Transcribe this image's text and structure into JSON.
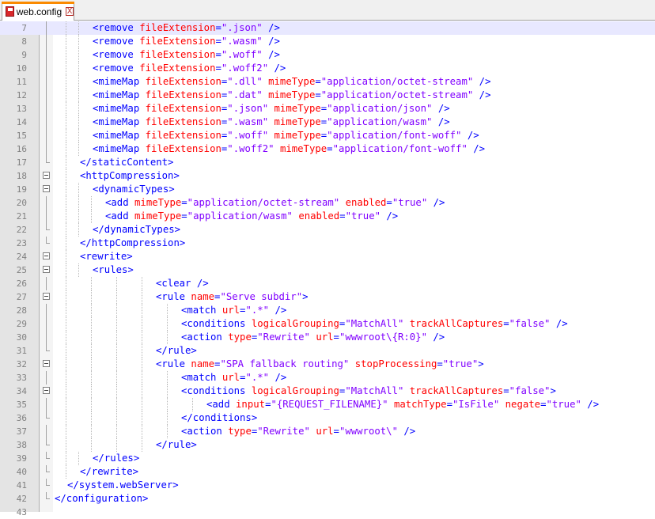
{
  "tab": {
    "label": "web.config",
    "close": "X"
  },
  "editor": {
    "current_line": 7,
    "lines": [
      {
        "n": "7",
        "indent": 3,
        "fold": "line",
        "tokens": [
          [
            "t",
            "<remove "
          ],
          [
            "a",
            "fileExtension"
          ],
          [
            "p",
            "="
          ],
          [
            "v",
            "\".json\""
          ],
          [
            "t",
            " />"
          ]
        ]
      },
      {
        "n": "8",
        "indent": 3,
        "fold": "line",
        "tokens": [
          [
            "t",
            "<remove "
          ],
          [
            "a",
            "fileExtension"
          ],
          [
            "p",
            "="
          ],
          [
            "v",
            "\".wasm\""
          ],
          [
            "t",
            " />"
          ]
        ]
      },
      {
        "n": "9",
        "indent": 3,
        "fold": "line",
        "tokens": [
          [
            "t",
            "<remove "
          ],
          [
            "a",
            "fileExtension"
          ],
          [
            "p",
            "="
          ],
          [
            "v",
            "\".woff\""
          ],
          [
            "t",
            " />"
          ]
        ]
      },
      {
        "n": "10",
        "indent": 3,
        "fold": "line",
        "tokens": [
          [
            "t",
            "<remove "
          ],
          [
            "a",
            "fileExtension"
          ],
          [
            "p",
            "="
          ],
          [
            "v",
            "\".woff2\""
          ],
          [
            "t",
            " />"
          ]
        ]
      },
      {
        "n": "11",
        "indent": 3,
        "fold": "line",
        "tokens": [
          [
            "t",
            "<mimeMap "
          ],
          [
            "a",
            "fileExtension"
          ],
          [
            "p",
            "="
          ],
          [
            "v",
            "\".dll\""
          ],
          [
            "t",
            " "
          ],
          [
            "a",
            "mimeType"
          ],
          [
            "p",
            "="
          ],
          [
            "v",
            "\"application/octet-stream\""
          ],
          [
            "t",
            " />"
          ]
        ]
      },
      {
        "n": "12",
        "indent": 3,
        "fold": "line",
        "tokens": [
          [
            "t",
            "<mimeMap "
          ],
          [
            "a",
            "fileExtension"
          ],
          [
            "p",
            "="
          ],
          [
            "v",
            "\".dat\""
          ],
          [
            "t",
            " "
          ],
          [
            "a",
            "mimeType"
          ],
          [
            "p",
            "="
          ],
          [
            "v",
            "\"application/octet-stream\""
          ],
          [
            "t",
            " />"
          ]
        ]
      },
      {
        "n": "13",
        "indent": 3,
        "fold": "line",
        "tokens": [
          [
            "t",
            "<mimeMap "
          ],
          [
            "a",
            "fileExtension"
          ],
          [
            "p",
            "="
          ],
          [
            "v",
            "\".json\""
          ],
          [
            "t",
            " "
          ],
          [
            "a",
            "mimeType"
          ],
          [
            "p",
            "="
          ],
          [
            "v",
            "\"application/json\""
          ],
          [
            "t",
            " />"
          ]
        ]
      },
      {
        "n": "14",
        "indent": 3,
        "fold": "line",
        "tokens": [
          [
            "t",
            "<mimeMap "
          ],
          [
            "a",
            "fileExtension"
          ],
          [
            "p",
            "="
          ],
          [
            "v",
            "\".wasm\""
          ],
          [
            "t",
            " "
          ],
          [
            "a",
            "mimeType"
          ],
          [
            "p",
            "="
          ],
          [
            "v",
            "\"application/wasm\""
          ],
          [
            "t",
            " />"
          ]
        ]
      },
      {
        "n": "15",
        "indent": 3,
        "fold": "line",
        "tokens": [
          [
            "t",
            "<mimeMap "
          ],
          [
            "a",
            "fileExtension"
          ],
          [
            "p",
            "="
          ],
          [
            "v",
            "\".woff\""
          ],
          [
            "t",
            " "
          ],
          [
            "a",
            "mimeType"
          ],
          [
            "p",
            "="
          ],
          [
            "v",
            "\"application/font-woff\""
          ],
          [
            "t",
            " />"
          ]
        ]
      },
      {
        "n": "16",
        "indent": 3,
        "fold": "line",
        "tokens": [
          [
            "t",
            "<mimeMap "
          ],
          [
            "a",
            "fileExtension"
          ],
          [
            "p",
            "="
          ],
          [
            "v",
            "\".woff2\""
          ],
          [
            "t",
            " "
          ],
          [
            "a",
            "mimeType"
          ],
          [
            "p",
            "="
          ],
          [
            "v",
            "\"application/font-woff\""
          ],
          [
            "t",
            " />"
          ]
        ]
      },
      {
        "n": "17",
        "indent": 2,
        "fold": "end",
        "tokens": [
          [
            "t",
            "</staticContent>"
          ]
        ]
      },
      {
        "n": "18",
        "indent": 2,
        "fold": "box",
        "tokens": [
          [
            "t",
            "<httpCompression>"
          ]
        ]
      },
      {
        "n": "19",
        "indent": 3,
        "fold": "box",
        "tokens": [
          [
            "t",
            "<dynamicTypes>"
          ]
        ]
      },
      {
        "n": "20",
        "indent": 4,
        "fold": "line",
        "tokens": [
          [
            "t",
            "<add "
          ],
          [
            "a",
            "mimeType"
          ],
          [
            "p",
            "="
          ],
          [
            "v",
            "\"application/octet-stream\""
          ],
          [
            "t",
            " "
          ],
          [
            "a",
            "enabled"
          ],
          [
            "p",
            "="
          ],
          [
            "v",
            "\"true\""
          ],
          [
            "t",
            " />"
          ]
        ]
      },
      {
        "n": "21",
        "indent": 4,
        "fold": "line",
        "tokens": [
          [
            "t",
            "<add "
          ],
          [
            "a",
            "mimeType"
          ],
          [
            "p",
            "="
          ],
          [
            "v",
            "\"application/wasm\""
          ],
          [
            "t",
            " "
          ],
          [
            "a",
            "enabled"
          ],
          [
            "p",
            "="
          ],
          [
            "v",
            "\"true\""
          ],
          [
            "t",
            " />"
          ]
        ]
      },
      {
        "n": "22",
        "indent": 3,
        "fold": "end",
        "tokens": [
          [
            "t",
            "</dynamicTypes>"
          ]
        ]
      },
      {
        "n": "23",
        "indent": 2,
        "fold": "end",
        "tokens": [
          [
            "t",
            "</httpCompression>"
          ]
        ]
      },
      {
        "n": "24",
        "indent": 2,
        "fold": "box",
        "tokens": [
          [
            "t",
            "<rewrite>"
          ]
        ]
      },
      {
        "n": "25",
        "indent": 3,
        "fold": "box",
        "tokens": [
          [
            "t",
            "<rules>"
          ]
        ]
      },
      {
        "n": "26",
        "indent": 8,
        "fold": "line",
        "tokens": [
          [
            "t",
            "<clear />"
          ]
        ]
      },
      {
        "n": "27",
        "indent": 8,
        "fold": "box",
        "tokens": [
          [
            "t",
            "<rule "
          ],
          [
            "a",
            "name"
          ],
          [
            "p",
            "="
          ],
          [
            "v",
            "\"Serve subdir\""
          ],
          [
            "t",
            ">"
          ]
        ]
      },
      {
        "n": "28",
        "indent": 10,
        "fold": "line",
        "tokens": [
          [
            "t",
            "<match "
          ],
          [
            "a",
            "url"
          ],
          [
            "p",
            "="
          ],
          [
            "v",
            "\".*\""
          ],
          [
            "t",
            " />"
          ]
        ]
      },
      {
        "n": "29",
        "indent": 10,
        "fold": "line",
        "tokens": [
          [
            "t",
            "<conditions "
          ],
          [
            "a",
            "logicalGrouping"
          ],
          [
            "p",
            "="
          ],
          [
            "v",
            "\"MatchAll\""
          ],
          [
            "t",
            " "
          ],
          [
            "a",
            "trackAllCaptures"
          ],
          [
            "p",
            "="
          ],
          [
            "v",
            "\"false\""
          ],
          [
            "t",
            " />"
          ]
        ]
      },
      {
        "n": "30",
        "indent": 10,
        "fold": "line",
        "tokens": [
          [
            "t",
            "<action "
          ],
          [
            "a",
            "type"
          ],
          [
            "p",
            "="
          ],
          [
            "v",
            "\"Rewrite\""
          ],
          [
            "t",
            " "
          ],
          [
            "a",
            "url"
          ],
          [
            "p",
            "="
          ],
          [
            "v",
            "\"wwwroot\\{R:0}\""
          ],
          [
            "t",
            " />"
          ]
        ]
      },
      {
        "n": "31",
        "indent": 8,
        "fold": "end",
        "tokens": [
          [
            "t",
            "</rule>"
          ]
        ]
      },
      {
        "n": "32",
        "indent": 8,
        "fold": "box",
        "tokens": [
          [
            "t",
            "<rule "
          ],
          [
            "a",
            "name"
          ],
          [
            "p",
            "="
          ],
          [
            "v",
            "\"SPA fallback routing\""
          ],
          [
            "t",
            " "
          ],
          [
            "a",
            "stopProcessing"
          ],
          [
            "p",
            "="
          ],
          [
            "v",
            "\"true\""
          ],
          [
            "t",
            ">"
          ]
        ]
      },
      {
        "n": "33",
        "indent": 10,
        "fold": "line",
        "tokens": [
          [
            "t",
            "<match "
          ],
          [
            "a",
            "url"
          ],
          [
            "p",
            "="
          ],
          [
            "v",
            "\".*\""
          ],
          [
            "t",
            " />"
          ]
        ]
      },
      {
        "n": "34",
        "indent": 10,
        "fold": "box",
        "tokens": [
          [
            "t",
            "<conditions "
          ],
          [
            "a",
            "logicalGrouping"
          ],
          [
            "p",
            "="
          ],
          [
            "v",
            "\"MatchAll\""
          ],
          [
            "t",
            " "
          ],
          [
            "a",
            "trackAllCaptures"
          ],
          [
            "p",
            "="
          ],
          [
            "v",
            "\"false\""
          ],
          [
            "t",
            ">"
          ]
        ]
      },
      {
        "n": "35",
        "indent": 12,
        "fold": "line",
        "tokens": [
          [
            "t",
            "<add "
          ],
          [
            "a",
            "input"
          ],
          [
            "p",
            "="
          ],
          [
            "v",
            "\"{REQUEST_FILENAME}\""
          ],
          [
            "t",
            " "
          ],
          [
            "a",
            "matchType"
          ],
          [
            "p",
            "="
          ],
          [
            "v",
            "\"IsFile\""
          ],
          [
            "t",
            " "
          ],
          [
            "a",
            "negate"
          ],
          [
            "p",
            "="
          ],
          [
            "v",
            "\"true\""
          ],
          [
            "t",
            " />"
          ]
        ]
      },
      {
        "n": "36",
        "indent": 10,
        "fold": "end",
        "tokens": [
          [
            "t",
            "</conditions>"
          ]
        ]
      },
      {
        "n": "37",
        "indent": 10,
        "fold": "line",
        "tokens": [
          [
            "t",
            "<action "
          ],
          [
            "a",
            "type"
          ],
          [
            "p",
            "="
          ],
          [
            "v",
            "\"Rewrite\""
          ],
          [
            "t",
            " "
          ],
          [
            "a",
            "url"
          ],
          [
            "p",
            "="
          ],
          [
            "v",
            "\"wwwroot\\\""
          ],
          [
            "t",
            " />"
          ]
        ]
      },
      {
        "n": "38",
        "indent": 8,
        "fold": "end",
        "tokens": [
          [
            "t",
            "</rule>"
          ]
        ]
      },
      {
        "n": "39",
        "indent": 3,
        "fold": "end",
        "tokens": [
          [
            "t",
            "</rules>"
          ]
        ]
      },
      {
        "n": "40",
        "indent": 2,
        "fold": "end",
        "tokens": [
          [
            "t",
            "</rewrite>"
          ]
        ]
      },
      {
        "n": "41",
        "indent": 1,
        "fold": "end",
        "tokens": [
          [
            "t",
            "</system.webServer>"
          ]
        ]
      },
      {
        "n": "42",
        "indent": 0,
        "fold": "end",
        "tokens": [
          [
            "t",
            "</configuration>"
          ]
        ]
      },
      {
        "n": "43",
        "indent": 0,
        "fold": "none",
        "tokens": []
      }
    ]
  }
}
